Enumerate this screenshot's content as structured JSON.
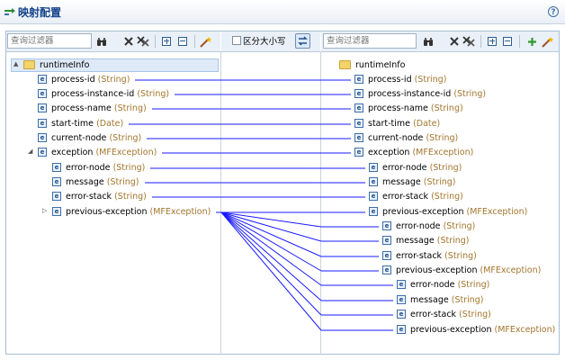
{
  "header": {
    "title": "映射配置",
    "help_label": "?"
  },
  "left_panel": {
    "filter_placeholder": "查询过滤器",
    "rows": [
      {
        "name": "runtimeInfo",
        "type": "",
        "kind": "folder"
      },
      {
        "name": "process-id",
        "type": "(String)",
        "kind": "element"
      },
      {
        "name": "process-instance-id",
        "type": "(String)",
        "kind": "element"
      },
      {
        "name": "process-name",
        "type": "(String)",
        "kind": "element"
      },
      {
        "name": "start-time",
        "type": "(Date)",
        "kind": "element"
      },
      {
        "name": "current-node",
        "type": "(String)",
        "kind": "element"
      },
      {
        "name": "exception",
        "type": "(MFException)",
        "kind": "element"
      },
      {
        "name": "error-node",
        "type": "(String)",
        "kind": "element"
      },
      {
        "name": "message",
        "type": "(String)",
        "kind": "element"
      },
      {
        "name": "error-stack",
        "type": "(String)",
        "kind": "element"
      },
      {
        "name": "previous-exception",
        "type": "(MFException)",
        "kind": "element"
      }
    ]
  },
  "middle": {
    "case_sensitive_label": "区分大小写"
  },
  "right_panel": {
    "filter_placeholder": "查询过滤器",
    "rows": [
      {
        "name": "runtimeInfo",
        "type": "",
        "kind": "folder"
      },
      {
        "name": "process-id",
        "type": "(String)",
        "kind": "element"
      },
      {
        "name": "process-instance-id",
        "type": "(String)",
        "kind": "element"
      },
      {
        "name": "process-name",
        "type": "(String)",
        "kind": "element"
      },
      {
        "name": "start-time",
        "type": "(Date)",
        "kind": "element"
      },
      {
        "name": "current-node",
        "type": "(String)",
        "kind": "element"
      },
      {
        "name": "exception",
        "type": "(MFException)",
        "kind": "element"
      },
      {
        "name": "error-node",
        "type": "(String)",
        "kind": "element"
      },
      {
        "name": "message",
        "type": "(String)",
        "kind": "element"
      },
      {
        "name": "error-stack",
        "type": "(String)",
        "kind": "element"
      },
      {
        "name": "previous-exception",
        "type": "(MFException)",
        "kind": "element"
      },
      {
        "name": "error-node",
        "type": "(String)",
        "kind": "element"
      },
      {
        "name": "message",
        "type": "(String)",
        "kind": "element"
      },
      {
        "name": "error-stack",
        "type": "(String)",
        "kind": "element"
      },
      {
        "name": "previous-exception",
        "type": "(MFException)",
        "kind": "element"
      },
      {
        "name": "error-node",
        "type": "(String)",
        "kind": "element"
      },
      {
        "name": "message",
        "type": "(String)",
        "kind": "element"
      },
      {
        "name": "error-stack",
        "type": "(String)",
        "kind": "element"
      },
      {
        "name": "previous-exception",
        "type": "(MFException)",
        "kind": "element"
      }
    ]
  },
  "mappings": [
    {
      "from": 1,
      "to": 1
    },
    {
      "from": 2,
      "to": 2
    },
    {
      "from": 3,
      "to": 3
    },
    {
      "from": 4,
      "to": 4
    },
    {
      "from": 5,
      "to": 5
    },
    {
      "from": 6,
      "to": 6
    },
    {
      "from": 7,
      "to": 7
    },
    {
      "from": 8,
      "to": 8
    },
    {
      "from": 9,
      "to": 9
    },
    {
      "from": 10,
      "to": 10
    },
    {
      "from": 10,
      "to": 11
    },
    {
      "from": 10,
      "to": 12
    },
    {
      "from": 10,
      "to": 13
    },
    {
      "from": 10,
      "to": 14
    },
    {
      "from": 10,
      "to": 15
    },
    {
      "from": 10,
      "to": 16
    },
    {
      "from": 10,
      "to": 17
    },
    {
      "from": 10,
      "to": 18
    }
  ],
  "colors": {
    "type_text": "#a3752c",
    "mapping_line": "#1a1aff",
    "header_title": "#15428b"
  },
  "icons": {
    "title": "mapping-arrows-icon",
    "toolbar": [
      "binoculars-icon",
      "delete-icon",
      "delete-all-icon",
      "expand-all-icon",
      "collapse-all-icon",
      "auto-map-wand-icon",
      "add-icon",
      "swap-icon"
    ],
    "node": "element-icon",
    "root": "folder-icon"
  }
}
